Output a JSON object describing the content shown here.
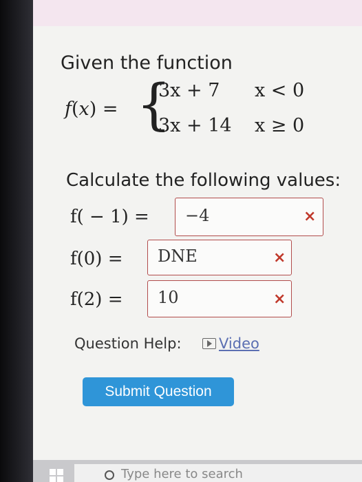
{
  "problem": {
    "intro": "Given the function",
    "fname": "f",
    "fvar": "x",
    "piece1_expr": "3x + 7",
    "piece1_cond": "x < 0",
    "piece2_expr": "3x + 14",
    "piece2_cond": "x ≥ 0"
  },
  "instructions": "Calculate the following values:",
  "answers": [
    {
      "label": "f( − 1) =",
      "value": "−4",
      "status": "incorrect"
    },
    {
      "label": "f(0) =",
      "value": "DNE",
      "status": "incorrect"
    },
    {
      "label": "f(2) =",
      "value": "10",
      "status": "incorrect"
    }
  ],
  "incorrect_mark": "×",
  "help": {
    "label": "Question Help:",
    "video_label": "Video"
  },
  "submit_label": "Submit Question",
  "taskbar": {
    "search_placeholder": "Type here to search"
  },
  "colors": {
    "error": "#c0392b",
    "submit": "#2f95d8",
    "link": "#5b6fb2"
  }
}
